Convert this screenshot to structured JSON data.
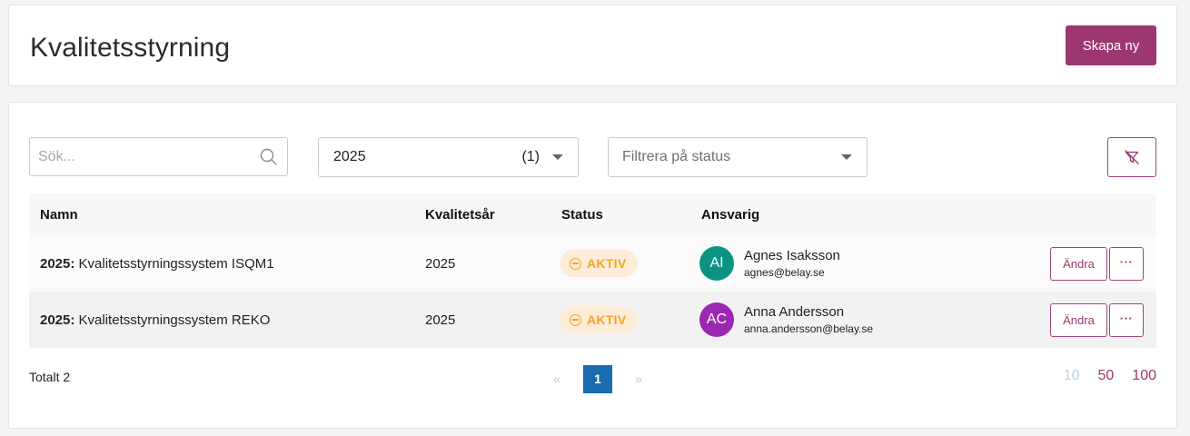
{
  "header": {
    "title": "Kvalitetsstyrning",
    "create_button": "Skapa ny"
  },
  "filters": {
    "search_placeholder": "Sök...",
    "year_value": "2025",
    "year_count": "(1)",
    "status_placeholder": "Filtrera på status"
  },
  "table": {
    "columns": {
      "name": "Namn",
      "year": "Kvalitetsår",
      "status": "Status",
      "responsible": "Ansvarig"
    },
    "rows": [
      {
        "name_prefix": "2025:",
        "name": " Kvalitetsstyrningssystem ISQM1",
        "year": "2025",
        "status": "AKTIV",
        "avatar_initials": "AI",
        "avatar_color": "#0b9382",
        "person_name": "Agnes Isaksson",
        "person_email": "agnes@belay.se",
        "edit_label": "Ändra",
        "more_label": "···"
      },
      {
        "name_prefix": "2025:",
        "name": " Kvalitetsstyrningssystem REKO",
        "year": "2025",
        "status": "AKTIV",
        "avatar_initials": "AC",
        "avatar_color": "#9c27b0",
        "person_name": "Anna Andersson",
        "person_email": "anna.andersson@belay.se",
        "edit_label": "Ändra",
        "more_label": "···"
      }
    ]
  },
  "footer": {
    "total": "Totalt 2",
    "prev": "«",
    "current_page": "1",
    "next": "»",
    "page_sizes": [
      "10",
      "50",
      "100"
    ]
  },
  "colors": {
    "brand": "#9c3770",
    "status_active_text": "#f5a425",
    "status_active_bg": "#fdecd8",
    "pager_active": "#1a6bb0"
  }
}
